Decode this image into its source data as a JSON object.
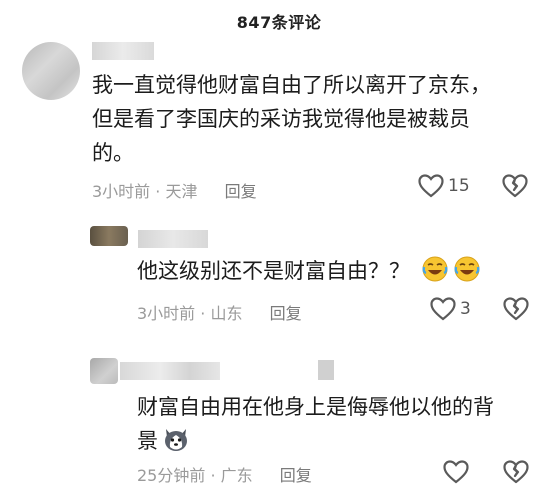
{
  "header": {
    "title": "847条评论"
  },
  "comments": [
    {
      "text_lines": [
        "我一直觉得他财富自由了所以离开了京东，",
        "但是看了李国庆的采访我觉得他是被裁员",
        "的。"
      ],
      "time": "3小时前",
      "location": "天津",
      "reply_label": "回复",
      "likes": "15"
    },
    {
      "text": "他这级别还不是财富自由？？",
      "emojis": [
        "laugh-cry-emoji",
        "laugh-cry-emoji"
      ],
      "time": "3小时前",
      "location": "山东",
      "reply_label": "回复",
      "likes": "3"
    },
    {
      "text_lines": [
        "财富自由用在他身上是侮辱他以他的背",
        "景"
      ],
      "emojis": [
        "husky-emoji"
      ],
      "time": "25分钟前",
      "location": "广东",
      "reply_label": "回复"
    }
  ],
  "colors": {
    "meta": "#9a9a9a",
    "text": "#1c1c1c",
    "icon": "#5a5a5a"
  }
}
